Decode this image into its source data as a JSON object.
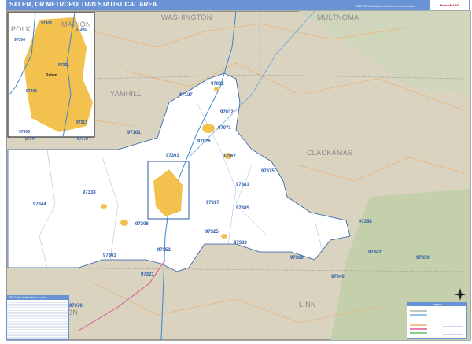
{
  "header": {
    "title": "SALEM, OR METROPOLITAN STATISTICAL AREA",
    "subtitle": "2025 ZIP Code Business Reference Inset Edition",
    "logo": "MarketMAPS"
  },
  "counties": [
    "WASHINGTON",
    "MULTNOMAH",
    "YAMHILL",
    "CLACKAMAS",
    "POLK",
    "MARION",
    "BENTON",
    "LINN"
  ],
  "zips": {
    "main": [
      "97002",
      "97137",
      "97032",
      "97071",
      "97026",
      "97101",
      "97362",
      "97303",
      "97375",
      "97381",
      "97338",
      "97344",
      "97317",
      "97385",
      "97358",
      "97306",
      "97325",
      "97383",
      "97342",
      "97350",
      "97361",
      "97352",
      "97360",
      "97346",
      "97321",
      "97370"
    ]
  },
  "inset": {
    "city": "Salem",
    "zips": [
      "97303",
      "97305",
      "97304",
      "97301",
      "97302",
      "97306",
      "97317",
      "97347",
      "97378"
    ]
  },
  "index_table": {
    "title": "ZIP Code Index/Grid Locator"
  },
  "legend": {
    "title": "Legend"
  },
  "colors": {
    "header": "#6a93d6",
    "land": "#d9d3c0",
    "metro": "#ffffff",
    "urban": "#f2c14e",
    "water": "#3a86d4",
    "road": "#f0b070"
  }
}
